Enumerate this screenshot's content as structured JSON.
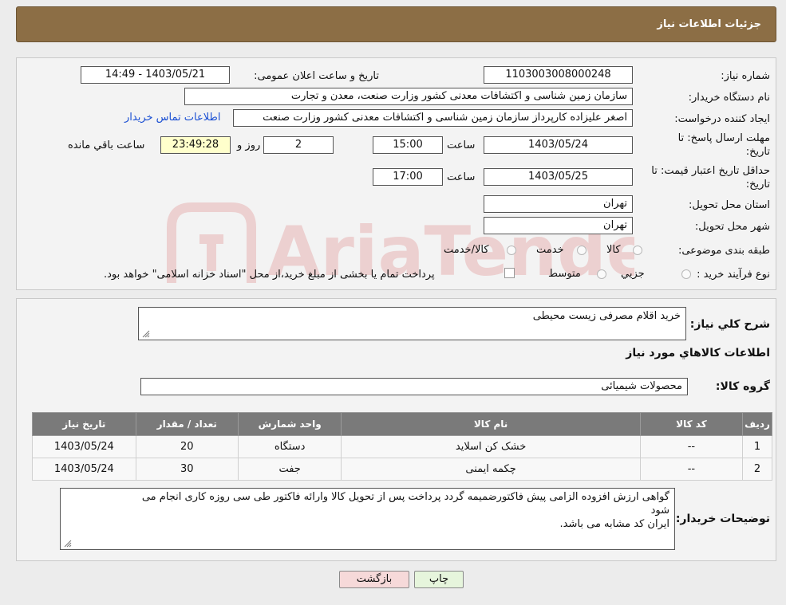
{
  "header": {
    "title": "جزئیات اطلاعات نیاز"
  },
  "form": {
    "need_number_label": "شماره نیاز:",
    "need_number": "1103003008000248",
    "announce_label": "تاریخ و ساعت اعلان عمومی:",
    "announce_value": "1403/05/21 - 14:49",
    "buyer_org_label": "نام دستگاه خریدار:",
    "buyer_org": "سازمان زمین شناسی و اکتشافات معدنی کشور وزارت صنعت، معدن و تجارت",
    "requester_label": "ایجاد کننده درخواست:",
    "requester": "اصغر علیزاده کارپرداز سازمان زمین شناسی و اکتشافات معدنی کشور وزارت صنعت",
    "contact_link": "اطلاعات تماس خریدار",
    "deadline_label_1": "مهلت ارسال پاسخ: تا",
    "deadline_label_2": "تاریخ:",
    "deadline_date": "1403/05/24",
    "time_label": "ساعت",
    "deadline_time": "15:00",
    "days_value": "2",
    "days_label": "روز و",
    "remaining_time": "23:49:28",
    "remaining_label": "ساعت باقي مانده",
    "validity_label_1": "حداقل تاریخ اعتبار قیمت: تا",
    "validity_label_2": "تاریخ:",
    "validity_date": "1403/05/25",
    "validity_time_label": "ساعت",
    "validity_time": "17:00",
    "province_label": "استان محل تحویل:",
    "province": "تهران",
    "city_label": "شهر محل تحویل:",
    "city": "تهران",
    "category_label": "طبقه بندی موضوعی:",
    "category_options": [
      "کالا",
      "خدمت",
      "کالا/خدمت"
    ],
    "process_label": "نوع فرآیند خرید :",
    "process_options": [
      "جزیي",
      "متوسط"
    ],
    "process_note": "پرداخت تمام یا بخشی از مبلغ خرید،از محل \"اسناد خزانه اسلامی\" خواهد بود."
  },
  "watermark": {
    "text": "AriaTender.neT"
  },
  "details": {
    "general_desc_label": "شرح کلي نیاز:",
    "general_desc": "خرید اقلام مصرفی زیست محیطی",
    "items_title": "اطلاعات کالاهاي مورد نیاز",
    "group_label": "گروه کالا:",
    "group_value": "محصولات شیمیائی",
    "table": {
      "headers": [
        "ردیف",
        "کد کالا",
        "نام کالا",
        "واحد شمارش",
        "تعداد / مقدار",
        "تاریخ نیاز"
      ],
      "rows": [
        [
          "1",
          "--",
          "خشک کن اسلاید",
          "دستگاه",
          "20",
          "1403/05/24"
        ],
        [
          "2",
          "--",
          "چکمه ایمنی",
          "جفت",
          "30",
          "1403/05/24"
        ]
      ]
    },
    "buyer_notes_label": "توضیحات خریدار:",
    "buyer_notes_lines": [
      "گواهی ارزش افزوده الزامی پیش فاکتورضمیمه گردد پرداخت پس از تحویل کالا وارائه فاکتور طی سی روزه کاری انجام می",
      "شود",
      "ایران کد مشابه می باشد."
    ]
  },
  "buttons": {
    "print": "چاپ",
    "back": "بازگشت"
  },
  "colors": {
    "header_bg": "#8c6e45",
    "link": "#1a4fd3",
    "highlight": "#ffffcc",
    "back_btn": "#f6d9d9",
    "print_btn": "#e6f5dc"
  }
}
